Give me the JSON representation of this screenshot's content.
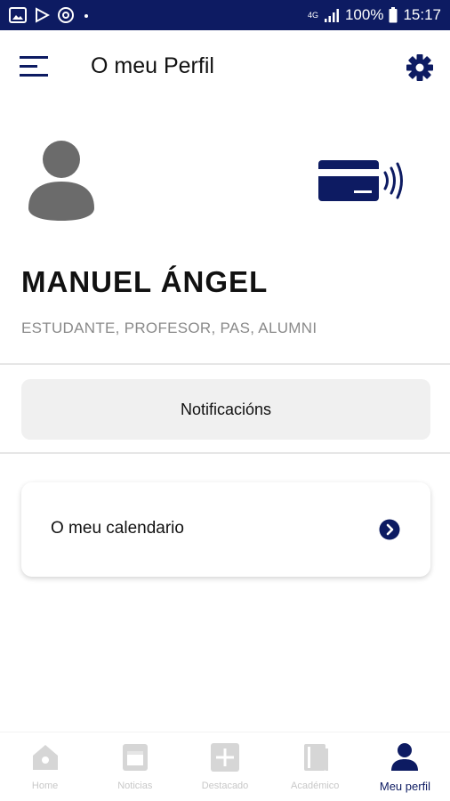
{
  "status_bar": {
    "network": "4G",
    "battery": "100%",
    "time": "15:17"
  },
  "header": {
    "title": "O meu Perfil"
  },
  "profile": {
    "name": "MANUEL ÁNGEL",
    "roles": "ESTUDANTE, PROFESOR, PAS, ALUMNI"
  },
  "actions": {
    "notifications_label": "Notificacións"
  },
  "calendar": {
    "label": "O meu calendario"
  },
  "bottom_nav": {
    "items": [
      {
        "label": "Home",
        "icon": "home-icon",
        "active": false
      },
      {
        "label": "Noticias",
        "icon": "news-icon",
        "active": false
      },
      {
        "label": "Destacado",
        "icon": "plus-icon",
        "active": false
      },
      {
        "label": "Académico",
        "icon": "book-icon",
        "active": false
      },
      {
        "label": "Meu perfil",
        "icon": "person-icon",
        "active": true
      }
    ]
  },
  "colors": {
    "brand": "#0d1b62",
    "muted_text": "#8a8a8a",
    "avatar_gray": "#6b6b6b",
    "inactive_icon": "#d6d6d6"
  }
}
